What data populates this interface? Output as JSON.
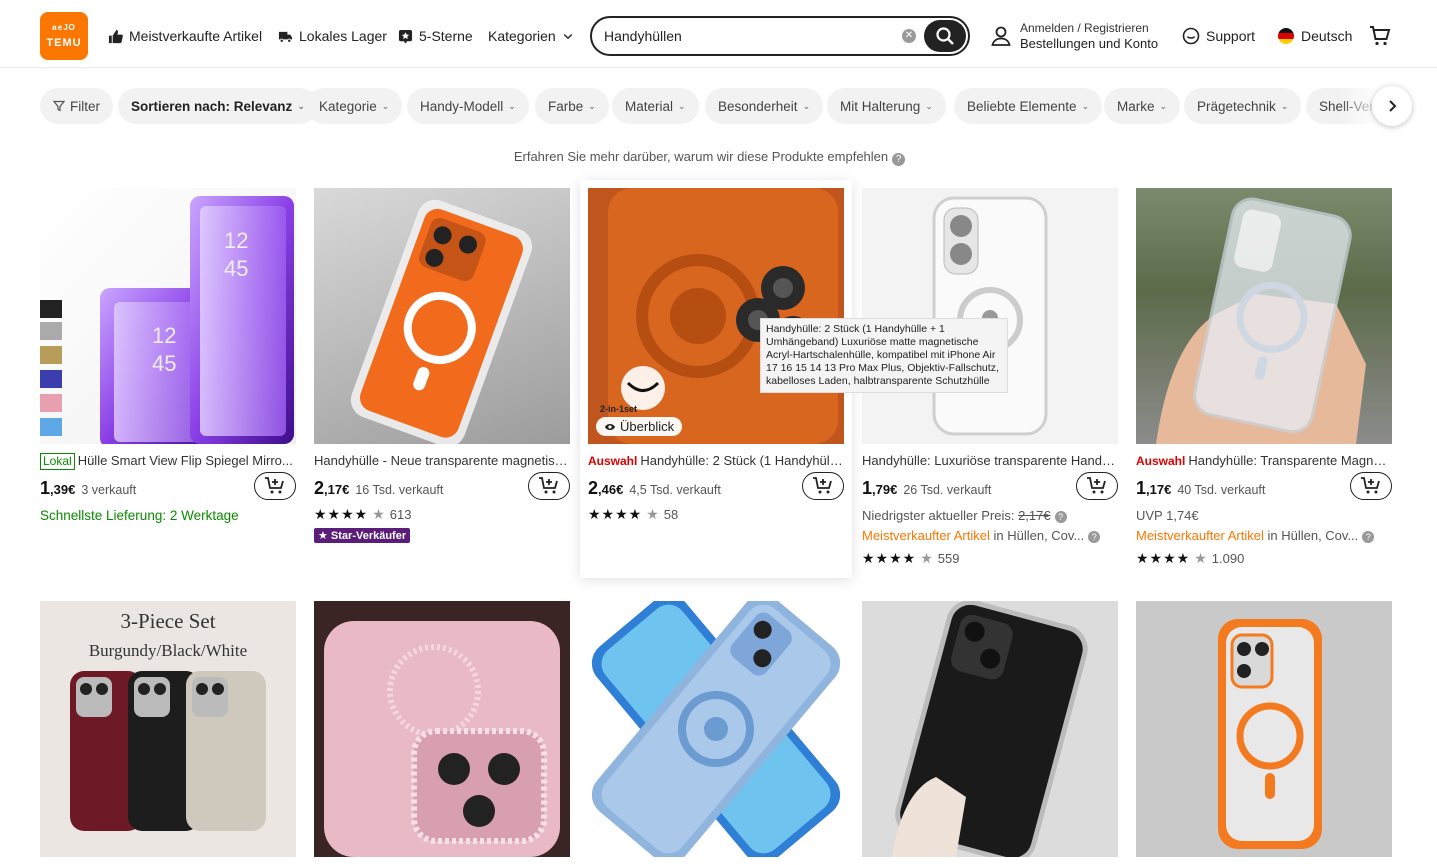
{
  "header": {
    "logo_line1": "ᵃᵉᴶᴼ",
    "logo_line2": "TEMU",
    "nav": [
      {
        "label": "Meistverkaufte Artikel"
      },
      {
        "label": "Lokales Lager"
      },
      {
        "label": "5-Sterne"
      },
      {
        "label": "Kategorien"
      }
    ],
    "search_value": "Handyhüllen",
    "account_line1": "Anmelden / Registrieren",
    "account_line2": "Bestellungen und Konto",
    "support": "Support",
    "language": "Deutsch"
  },
  "filters": {
    "items": [
      "Filter",
      "Sortieren nach: Relevanz",
      "Kategorie",
      "Handy-Modell",
      "Farbe",
      "Material",
      "Besonderheit",
      "Mit Halterung",
      "Beliebte Elemente",
      "Marke",
      "Prägetechnik",
      "Shell-Ver"
    ]
  },
  "info_text": "Erfahren Sie mehr darüber, warum wir diese Produkte empfehlen",
  "products": [
    {
      "badge": "Lokal",
      "title": "Hülle Smart View Flip Spiegel Mirro...",
      "price_int": "1",
      "price_dec": ",39€",
      "sold": "3 verkauft",
      "line3": "Schnellste Lieferung: 2 Werktage"
    },
    {
      "title": "Handyhülle - Neue transparente magnetisc...",
      "price_int": "2",
      "price_dec": ",17€",
      "sold": "16 Tsd. verkauft",
      "rating_count": "613",
      "star_seller": "★ Star-Verkäufer"
    },
    {
      "badge": "Auswahl",
      "title": "Handyhülle: 2 Stück (1 Handyhülle ...",
      "price_int": "2",
      "price_dec": ",46€",
      "sold": "4,5 Tsd. verkauft",
      "rating_count": "58",
      "overview": "Überblick",
      "img_label": "2-in-1set"
    },
    {
      "title": "Handyhülle: Luxuriöse transparente Handy...",
      "price_int": "1",
      "price_dec": ",79€",
      "sold": "26 Tsd. verkauft",
      "line3_prefix": "Niedrigster aktueller Preis: ",
      "line3_strike": "2,17€",
      "line4_orange": "Meistverkaufter Artikel",
      "line4_rest": " in Hüllen, Cov...",
      "rating_count": "559"
    },
    {
      "badge": "Auswahl",
      "title": "Handyhülle: Transparente Magnetis...",
      "price_int": "1",
      "price_dec": ",17€",
      "sold": "40 Tsd. verkauft",
      "line3_prefix": "UVP 1,74€",
      "line4_orange": "Meistverkaufter Artikel",
      "line4_rest": " in Hüllen, Cov...",
      "rating_count": "1.090"
    }
  ],
  "row2_labels": {
    "set_title": "3-Piece Set",
    "set_colors": "Burgundy/Black/White"
  },
  "tooltip": "Handyhülle: 2 Stück (1 Handyhülle + 1 Umhängeband) Luxuriöse matte magnetische Acryl-Hartschalenhülle, kompatibel mit iPhone Air 17 16 15 14 13 Pro Max Plus, Objektiv-Fallschutz, kabelloses Laden, halbtransparente Schutzhülle",
  "colors": {
    "brand": "#fb7701",
    "green": "#0a8a00",
    "auswahl_red": "#dd0000",
    "star_seller_purple": "#5a1d7a"
  }
}
